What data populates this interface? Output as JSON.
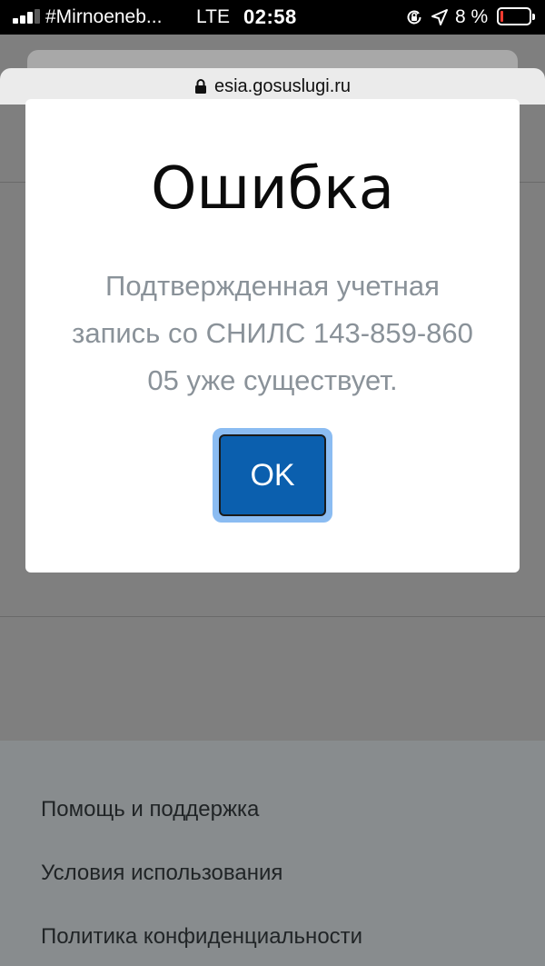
{
  "status_bar": {
    "carrier": "#Mirnoeneb...",
    "network": "LTE",
    "time": "02:58",
    "battery_percent": "8 %",
    "battery_level": 0.08,
    "battery_color": "#ff3b30"
  },
  "browser": {
    "url": "esia.gosuslugi.ru"
  },
  "dialog": {
    "title": "Ошибка",
    "message": "Подтвержденная учетная запись со СНИЛС 143-859-860 05 уже существует.",
    "ok_label": "OK",
    "button_color": "#0b5fae"
  },
  "footer": {
    "links": [
      "Помощь и поддержка",
      "Условия использования",
      "Политика конфиденциальности"
    ]
  }
}
